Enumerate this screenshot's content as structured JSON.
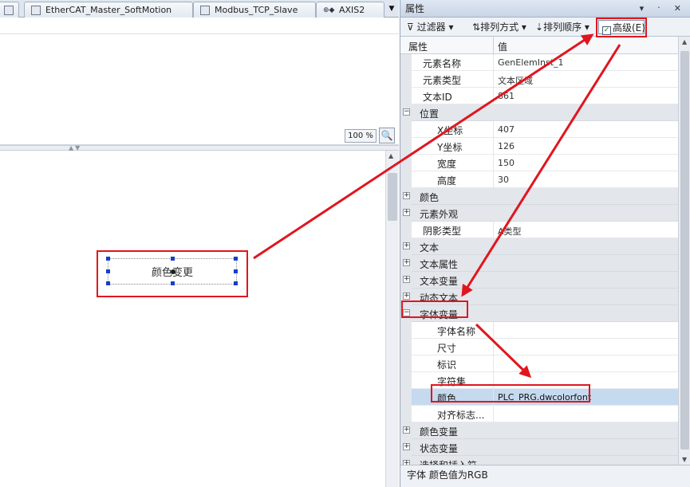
{
  "tabs": [
    {
      "label": ""
    },
    {
      "label": "EtherCAT_Master_SoftMotion"
    },
    {
      "label": "Modbus_TCP_Slave"
    },
    {
      "label": "AXIS2"
    }
  ],
  "tab_overflow_icon": "chevron-down-icon",
  "zoom": {
    "value": "100 %"
  },
  "canvas": {
    "element_text": "颜色变更"
  },
  "properties": {
    "title": "属性",
    "title_buttons": "▾ ᛫ ✕",
    "toolbar": {
      "filter": "过滤器",
      "sort_by": "排列方式",
      "sort_order": "排列顺序",
      "advanced": "高级(E)",
      "advanced_checked": true
    },
    "columns": {
      "name": "属性",
      "value": "值"
    },
    "rows": [
      {
        "label": "元素名称",
        "value": "GenElemInst_1",
        "kind": "l1"
      },
      {
        "label": "元素类型",
        "value": "文本区域",
        "kind": "l1"
      },
      {
        "label": "文本ID",
        "value": "861",
        "kind": "l1"
      },
      {
        "label": "位置",
        "value": "",
        "kind": "cat",
        "expander": "−"
      },
      {
        "label": "X坐标",
        "value": "407",
        "kind": "l2"
      },
      {
        "label": "Y坐标",
        "value": "126",
        "kind": "l2"
      },
      {
        "label": "宽度",
        "value": "150",
        "kind": "l2"
      },
      {
        "label": "高度",
        "value": "30",
        "kind": "l2"
      },
      {
        "label": "颜色",
        "value": "",
        "kind": "cat",
        "expander": "+"
      },
      {
        "label": "元素外观",
        "value": "",
        "kind": "cat",
        "expander": "+"
      },
      {
        "label": "阴影类型",
        "value": "A类型",
        "kind": "l1"
      },
      {
        "label": "文本",
        "value": "",
        "kind": "cat",
        "expander": "+"
      },
      {
        "label": "文本属性",
        "value": "",
        "kind": "cat",
        "expander": "+"
      },
      {
        "label": "文本变量",
        "value": "",
        "kind": "cat",
        "expander": "+"
      },
      {
        "label": "动态文本",
        "value": "",
        "kind": "cat",
        "expander": "+"
      },
      {
        "label": "字体变量",
        "value": "",
        "kind": "cat",
        "expander": "−"
      },
      {
        "label": "字体名称",
        "value": "",
        "kind": "l2"
      },
      {
        "label": "尺寸",
        "value": "",
        "kind": "l2"
      },
      {
        "label": "标识",
        "value": "",
        "kind": "l2"
      },
      {
        "label": "字符集",
        "value": "",
        "kind": "l2"
      },
      {
        "label": "颜色",
        "value": "PLC_PRG.dwcolorfont",
        "kind": "l2",
        "selected": true
      },
      {
        "label": "对齐标志...",
        "value": "",
        "kind": "l2"
      },
      {
        "label": "颜色变量",
        "value": "",
        "kind": "cat",
        "expander": "+"
      },
      {
        "label": "状态变量",
        "value": "",
        "kind": "cat",
        "expander": "+"
      },
      {
        "label": "选择和插入符...",
        "value": "",
        "kind": "cat",
        "expander": "+"
      }
    ],
    "status": "字体 颜色值为RGB"
  },
  "annotation_color": "#e0161e",
  "selection_color": "#c5d9ef",
  "handle_color": "#1540c8"
}
